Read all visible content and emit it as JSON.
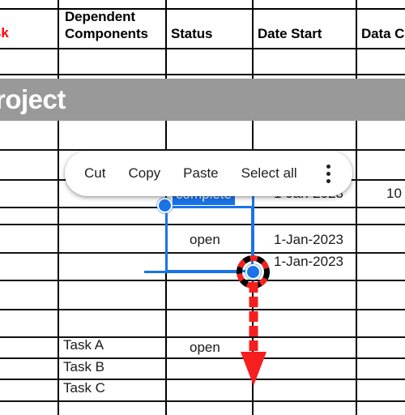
{
  "app": {
    "kind": "spreadsheet-cell-selection"
  },
  "table": {
    "headers": [
      {
        "label": "sk",
        "color": "#ff0000",
        "truncated_from": "Task"
      },
      {
        "label": "Dependent\nComponents",
        "color": "#000000"
      },
      {
        "label": "Status",
        "color": "#000000"
      },
      {
        "label": "Date Start",
        "color": "#000000"
      },
      {
        "label": "Data C",
        "color": "#000000",
        "truncated_from": "Data Complete"
      }
    ],
    "header_line1": "Dependent",
    "header_line2": "Components",
    "header_status": "Status",
    "header_date_start": "Date Start",
    "header_data_c": "Data C",
    "header_task_partial": "sk"
  },
  "banner": {
    "title": "roject",
    "truncated_from": "Project",
    "background": "#999999",
    "text_color": "#ffffff"
  },
  "cells": {
    "status_complete": "complete",
    "status_open_selected": "open",
    "status_open_lower": "open",
    "date_row_a": "1-Jan-2023",
    "date_row_b": "1-Jan-2023",
    "date_row_c": "1-Jan-2023",
    "data_complete_partial": "10",
    "task_a": "Task A",
    "task_b": "Task B",
    "task_c": "Task C"
  },
  "context_menu": {
    "items": [
      {
        "label": "Cut"
      },
      {
        "label": "Copy"
      },
      {
        "label": "Paste"
      },
      {
        "label": "Select all"
      }
    ],
    "cut": "Cut",
    "copy": "Copy",
    "paste": "Paste",
    "select_all": "Select all",
    "overflow_icon": "more-vertical-icon"
  },
  "selection": {
    "accent_color": "#1a73e8",
    "handle_top_left": "selection-handle-top-left",
    "handle_bottom_right": "selection-handle-bottom-right",
    "drag_indicator_color": "#f61e1e",
    "drag_direction": "down"
  }
}
